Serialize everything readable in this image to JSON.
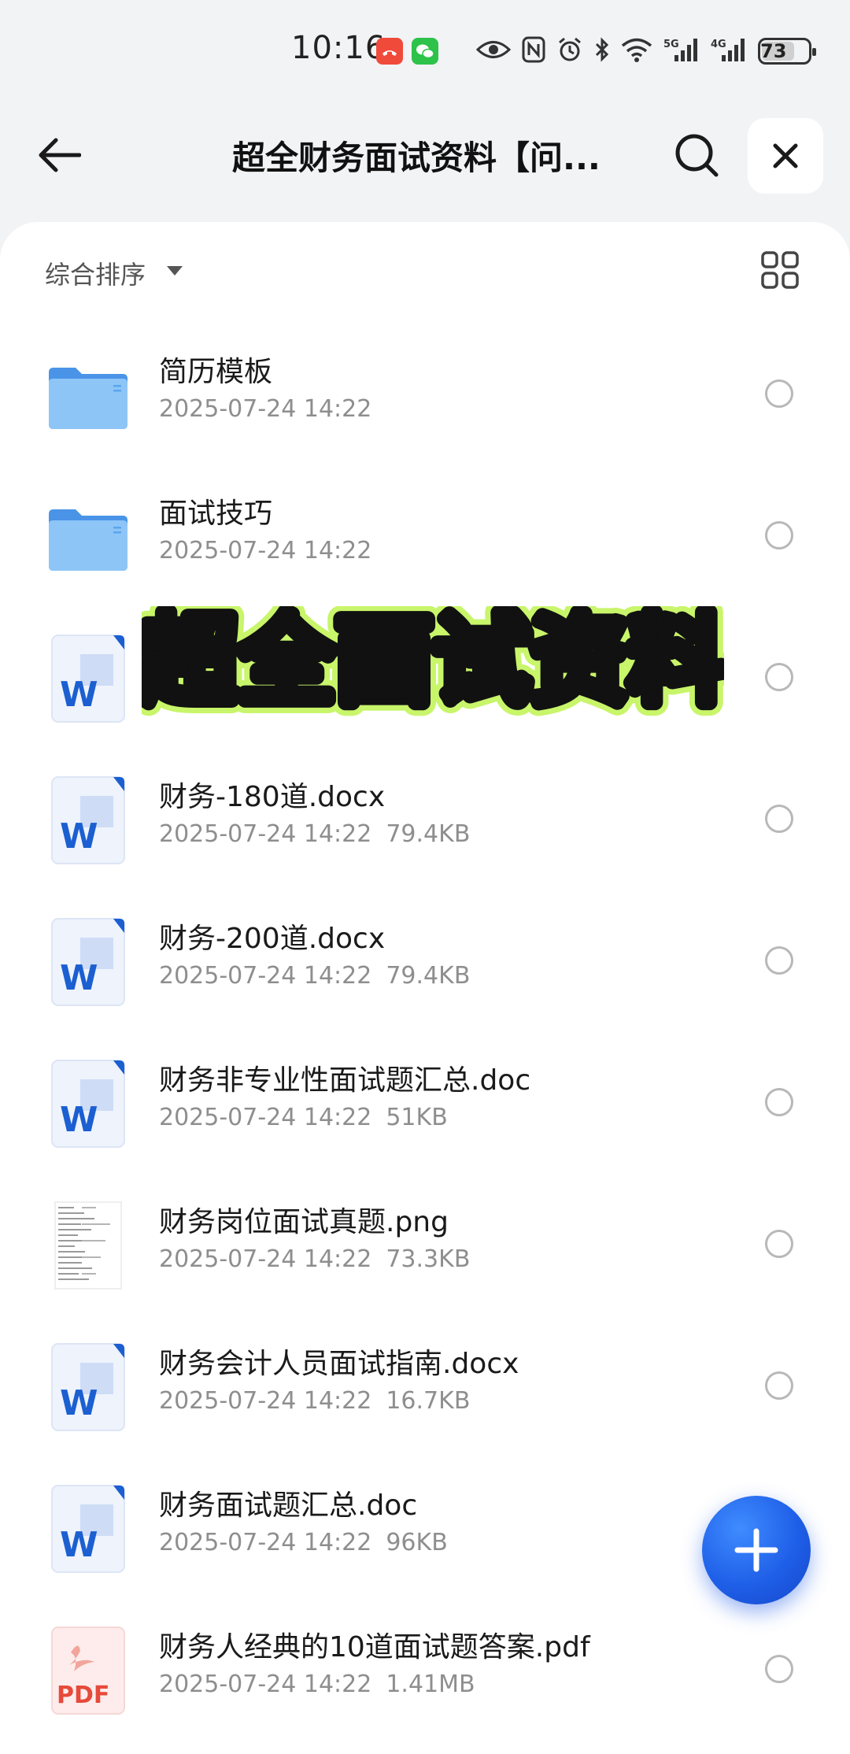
{
  "status_bar": {
    "time": "10:16",
    "network_5g": "5G",
    "network_4g": "4G",
    "battery": "73",
    "battery_level": 0.73
  },
  "top_bar": {
    "title": "超全财务面试资料【问...",
    "icons": {
      "back": "arrow-left-icon",
      "search": "search-icon",
      "close": "close-icon"
    }
  },
  "toolbar": {
    "sort_label": "综合排序",
    "icons": {
      "sort": "caret-down-icon",
      "view": "grid-view-icon"
    }
  },
  "overlay": {
    "text": "超全面试资料",
    "fill_color": "#c8f56a",
    "stroke_color": "#111111"
  },
  "files": [
    {
      "type": "folder",
      "icon": "folder-icon",
      "name": "简历模板",
      "date": "2025-07-24 14:22",
      "size": ""
    },
    {
      "type": "folder",
      "icon": "folder-icon",
      "name": "面试技巧",
      "date": "2025-07-24 14:22",
      "size": ""
    },
    {
      "type": "word",
      "icon": "word-doc-icon",
      "name": "",
      "date": "",
      "size": ""
    },
    {
      "type": "word",
      "icon": "word-doc-icon",
      "name": "财务-180道.docx",
      "date": "2025-07-24 14:22",
      "size": "79.4KB"
    },
    {
      "type": "word",
      "icon": "word-doc-icon",
      "name": "财务-200道.docx",
      "date": "2025-07-24 14:22",
      "size": "79.4KB"
    },
    {
      "type": "word",
      "icon": "word-doc-icon",
      "name": "财务非专业性面试题汇总.doc",
      "date": "2025-07-24 14:22",
      "size": "51KB"
    },
    {
      "type": "image",
      "icon": "image-thumbnail-icon",
      "name": "财务岗位面试真题.png",
      "date": "2025-07-24 14:22",
      "size": "73.3KB"
    },
    {
      "type": "word",
      "icon": "word-doc-icon",
      "name": "财务会计人员面试指南.docx",
      "date": "2025-07-24 14:22",
      "size": "16.7KB"
    },
    {
      "type": "word",
      "icon": "word-doc-icon",
      "name": "财务面试题汇总.doc",
      "date": "2025-07-24 14:22",
      "size": "96KB"
    },
    {
      "type": "pdf",
      "icon": "pdf-icon",
      "name": "财务人经典的10道面试题答案.pdf",
      "date": "2025-07-24 14:22",
      "size": "1.41MB"
    }
  ],
  "fab": {
    "icon": "plus-icon",
    "color": "#1f5fe8"
  },
  "colors": {
    "accent": "#1f5fe8",
    "folder": "#6fb3f5",
    "word": "#1b5fd1",
    "pdf": "#e64a3b"
  }
}
